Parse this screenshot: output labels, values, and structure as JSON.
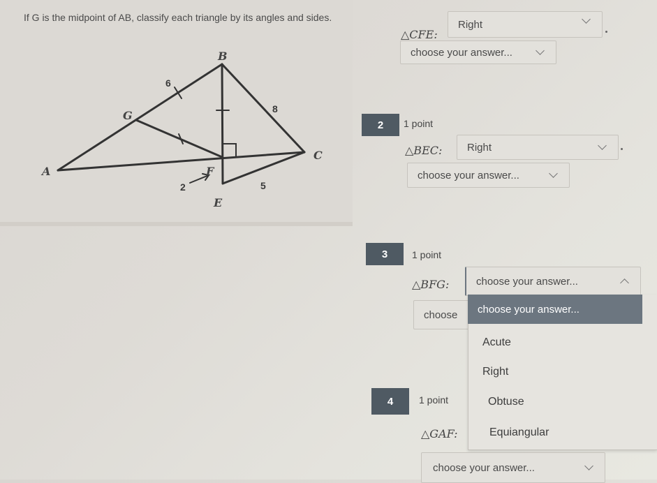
{
  "question1": {
    "prompt": "If G is the midpoint of AB, classify each triangle by its angles and sides.",
    "diagram": {
      "vertices": [
        "A",
        "B",
        "C",
        "E",
        "F",
        "G"
      ],
      "segment_labels": {
        "BG": "6",
        "BC": "8",
        "EC": "5",
        "EF": "2"
      }
    },
    "triangle": "△CFE:",
    "angle_select": {
      "value": "Right"
    },
    "side_select": {
      "value": "choose your answer..."
    }
  },
  "question2": {
    "number": "2",
    "points": "1 point",
    "triangle": "△BEC:",
    "angle_select": {
      "value": "Right"
    },
    "side_select": {
      "value": "choose your answer..."
    }
  },
  "question3": {
    "number": "3",
    "points": "1 point",
    "triangle": "△BFG:",
    "angle_select": {
      "value": "choose your answer...",
      "open": true
    },
    "side_select": {
      "value_partial": "choose"
    },
    "dropdown": {
      "highlighted": "choose your answer...",
      "options": [
        "Acute",
        "Right",
        "Obtuse",
        "Equiangular"
      ]
    }
  },
  "question4": {
    "number": "4",
    "points": "1 point",
    "triangle": "△GAF:",
    "side_select": {
      "value": "choose your answer..."
    }
  }
}
